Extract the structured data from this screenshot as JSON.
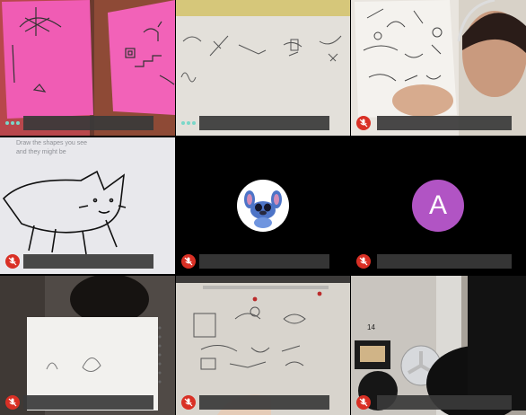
{
  "meeting": {
    "tiles": [
      {
        "id": "tile-1",
        "muted": false,
        "speaking": true
      },
      {
        "id": "tile-2",
        "muted": false,
        "speaking": true
      },
      {
        "id": "tile-3",
        "muted": true
      },
      {
        "id": "tile-4",
        "muted": true
      },
      {
        "id": "tile-5",
        "muted": true,
        "avatar": "stitch-avatar-icon"
      },
      {
        "id": "tile-6",
        "muted": true,
        "avatar_initial": "A",
        "avatar_color": "#b154c4"
      },
      {
        "id": "tile-7",
        "muted": true
      },
      {
        "id": "tile-8",
        "muted": true
      },
      {
        "id": "tile-9",
        "muted": true
      }
    ],
    "colors": {
      "mute_badge": "#d93025",
      "name_bar": "#3a3a3a",
      "speaking_indicator": "#7ad7c9"
    },
    "drawing_text": {
      "tile4_line1": "Draw the shapes you see",
      "tile4_line2": "and they might be",
      "tile9_label": "14"
    }
  }
}
